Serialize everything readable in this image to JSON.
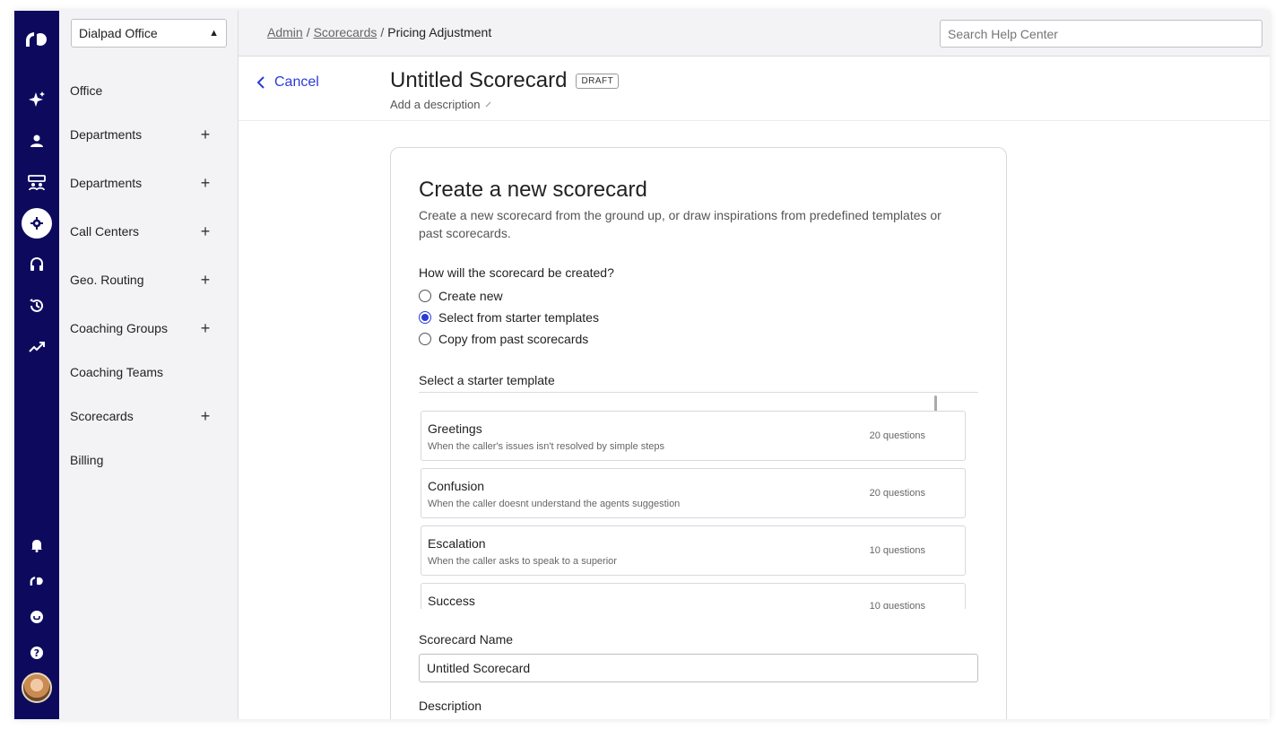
{
  "rail": {
    "colors": {
      "bg": "#0d0a5e",
      "accent": "#2b3bd6"
    },
    "icons": [
      "dialpad-logo-icon",
      "sparkle-icon",
      "person-icon",
      "contact-center-icon",
      "gear-icon",
      "headset-icon",
      "history-icon",
      "trend-icon",
      "bell-icon",
      "dialpad-logo-icon",
      "smile-icon",
      "help-icon",
      "avatar"
    ]
  },
  "subnav": {
    "office_select": "Dialpad Office",
    "items": [
      {
        "label": "Office",
        "plus": false
      },
      {
        "label": "Departments",
        "plus": true
      },
      {
        "label": "Departments",
        "plus": true
      },
      {
        "label": "Call Centers",
        "plus": true
      },
      {
        "label": "Geo. Routing",
        "plus": true
      },
      {
        "label": "Coaching Groups",
        "plus": true
      },
      {
        "label": "Coaching Teams",
        "plus": false
      },
      {
        "label": "Scorecards",
        "plus": true
      },
      {
        "label": "Billing",
        "plus": false
      }
    ],
    "plus_glyph": "+"
  },
  "topbar": {
    "breadcrumb": {
      "admin": "Admin",
      "sep": "/",
      "scorecards": "Scorecards",
      "current": "Pricing Adjustment"
    },
    "search_placeholder": "Search Help Center"
  },
  "page_head": {
    "cancel": "Cancel",
    "title": "Untitled Scorecard",
    "badge": "DRAFT",
    "add_description": "Add a description"
  },
  "panel": {
    "title": "Create a new scorecard",
    "subtitle": "Create a new scorecard from the ground up, or draw inspirations from predefined templates or past scorecards.",
    "question": "How will the scorecard be created?",
    "options": [
      {
        "label": "Create new",
        "selected": false
      },
      {
        "label": "Select from starter templates",
        "selected": true
      },
      {
        "label": "Copy from past scorecards",
        "selected": false
      }
    ],
    "template_label": "Select a starter template",
    "templates": [
      {
        "name": "Greetings",
        "desc": "When the caller's issues isn't resolved by simple steps",
        "count": "20 questions"
      },
      {
        "name": "Confusion",
        "desc": "When the caller doesnt understand the agents suggestion",
        "count": "20 questions"
      },
      {
        "name": "Escalation",
        "desc": "When the caller asks to speak to a superior",
        "count": "10 questions"
      },
      {
        "name": "Success",
        "desc": "",
        "count": "10 questions"
      }
    ],
    "name_label": "Scorecard Name",
    "name_value": "Untitled Scorecard",
    "description_label": "Description"
  }
}
